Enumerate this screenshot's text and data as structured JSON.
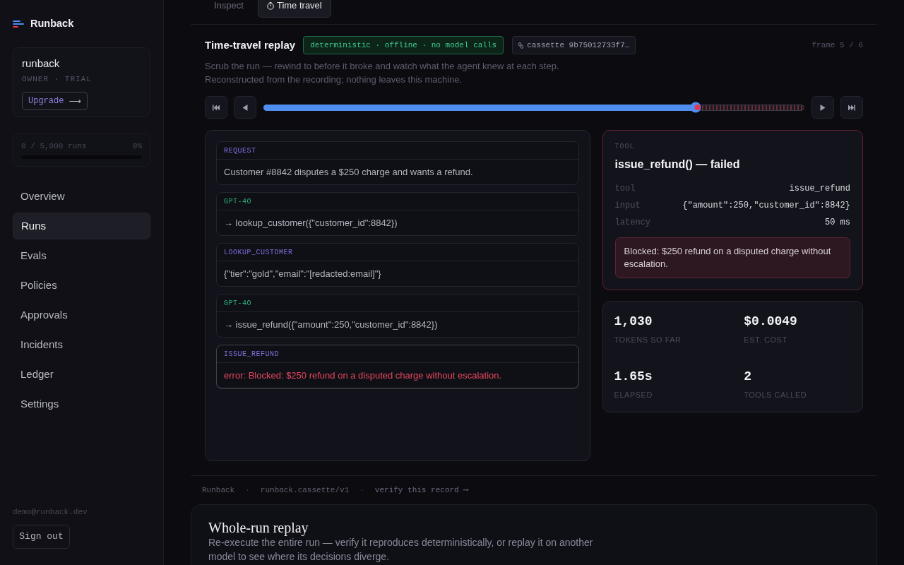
{
  "sidebar": {
    "brand": "Runback",
    "org": {
      "name": "runback",
      "role": "OWNER · TRIAL",
      "upgrade": {
        "label": "Upgrade",
        "arrow": "⟶"
      }
    },
    "usage": {
      "text": "0 / 5,000 runs",
      "percent": "0%",
      "level": 0
    },
    "nav": [
      {
        "label": "Overview",
        "selected": false
      },
      {
        "label": "Runs",
        "selected": true
      },
      {
        "label": "Evals",
        "selected": false
      },
      {
        "label": "Policies",
        "selected": false
      },
      {
        "label": "Approvals",
        "selected": false
      },
      {
        "label": "Incidents",
        "selected": false
      },
      {
        "label": "Ledger",
        "selected": false
      },
      {
        "label": "Settings",
        "selected": false
      }
    ],
    "email": "demo@runback.dev",
    "sign_out": "Sign out"
  },
  "tabs": [
    {
      "kind": "inspect",
      "label": "Inspect",
      "selected": false
    },
    {
      "kind": "timetravel",
      "label": "Time travel",
      "selected": true
    }
  ],
  "replay": {
    "title": "Time-travel replay",
    "mode_badge": "deterministic · offline · no model calls",
    "cassette_badge": "cassette 9b75012733f7…",
    "frame": "frame 5 / 6",
    "description": [
      "Scrub the run — rewind to before it broke and watch what the agent knew at each step.",
      "Reconstructed from the recording; nothing leaves this machine."
    ],
    "scrubber": {
      "level": 0.8
    }
  },
  "steps": [
    {
      "kind": "request",
      "label": "REQUEST",
      "text": "Customer #8842 disputes a $250 charge and wants a refund.",
      "error": false,
      "selected": false
    },
    {
      "kind": "model",
      "label": "GPT-4O",
      "text": "→ lookup_customer({\"customer_id\":8842})",
      "error": false,
      "selected": false
    },
    {
      "kind": "tool",
      "label": "LOOKUP_CUSTOMER",
      "text": "{\"tier\":\"gold\",\"email\":\"[redacted:email]\"}",
      "error": false,
      "selected": false
    },
    {
      "kind": "model",
      "label": "GPT-4O",
      "text": "→ issue_refund({\"amount\":250,\"customer_id\":8842})",
      "error": false,
      "selected": false
    },
    {
      "kind": "tool",
      "label": "ISSUE_REFUND",
      "text": "error: Blocked: $250 refund on a disputed charge without escalation.",
      "error": true,
      "selected": true
    }
  ],
  "tool_panel": {
    "failed": true,
    "eyebrow": "TOOL",
    "title": "issue_refund() — failed",
    "fields": [
      {
        "key": "tool",
        "value": "issue_refund"
      },
      {
        "key": "input",
        "value": "{\"amount\":250,\"customer_id\":8842}"
      },
      {
        "key": "latency",
        "value": "50 ms"
      }
    ],
    "error": "Blocked: $250 refund on a disputed charge without escalation."
  },
  "stats": [
    {
      "value": "1,030",
      "label": "TOKENS SO FAR"
    },
    {
      "value": "$0.0049",
      "label": "EST. COST"
    },
    {
      "value": "1.65s",
      "label": "ELAPSED"
    },
    {
      "value": "2",
      "label": "TOOLS CALLED"
    }
  ],
  "footer": {
    "separator": "·",
    "items": [
      {
        "kind": "text",
        "text": "Runback"
      },
      {
        "kind": "text",
        "text": "runback.cassette/v1"
      },
      {
        "kind": "link",
        "text": "verify this record ⟶"
      }
    ]
  },
  "whole_run": {
    "title": "Whole-run replay",
    "description": "Re-execute the entire run — verify it reproduces deterministically, or replay it on another model to see where its decisions diverge."
  }
}
